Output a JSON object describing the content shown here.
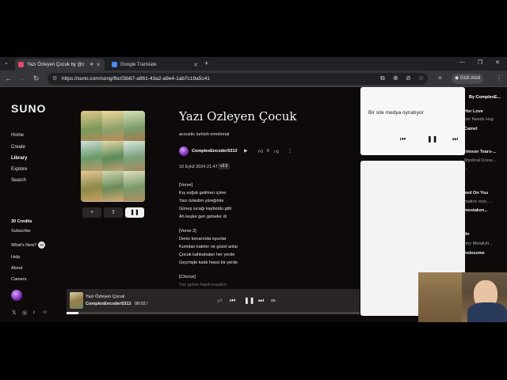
{
  "browser": {
    "tabs": [
      {
        "title": "Yazı Özleyen Çocuk by @c",
        "active": true
      },
      {
        "title": "Google Translate",
        "active": false
      }
    ],
    "url": "https://suno.com/song/fbc03b87-a861-43a2-a9e4-1ab7c19a5c41",
    "incognito_label": "Gizli mod"
  },
  "sidebar": {
    "logo": "SUNO",
    "items": [
      "Home",
      "Create",
      "Library",
      "Explore",
      "Search"
    ],
    "credits": "30 Credits",
    "subscribe": "Subscribe",
    "whats_new": "What's New?",
    "whats_new_count": "20",
    "links": [
      "Help",
      "About",
      "Careers"
    ]
  },
  "song": {
    "title": "Yazı Ozleyen Çocuk",
    "tags": "acoustic turkish emotional",
    "creator": "ComplexEncoder5313",
    "likes": "6",
    "date": "10 Eylül 2024 21:47",
    "version": "v3.5",
    "lyrics": [
      "[Verse]",
      "Kış soğuk gelirken içime",
      "Yazı özledim yüreğimle",
      "Güneş sıcağı kayboldu gitti",
      "Ah keşke geri gelseler di",
      "",
      "[Verse 2]",
      "Deniz kenarında oyunlar",
      "Kumdan kaleler ne güzel anlar",
      "Çocuk kahkahaları her yerde",
      "Geçmişte kaldı hepsi bir yerde",
      "",
      "[Chorus]",
      "Yaz gelsin haydi koşalım"
    ]
  },
  "player": {
    "title": "Yazı Özleyen Çocuk",
    "artist": "ComplexEncoder5313",
    "time": "00:02 / ",
    "progress": 0.04
  },
  "right_list": {
    "header": "By ComplexE...",
    "items": [
      {
        "text": "Hor Love",
        "dim": false
      },
      {
        "text": "hor Needs Hug",
        "dim": true
      },
      {
        "text": "Camel",
        "dim": false
      },
      {
        "text": "rimson Tears-...",
        "dim": false
      },
      {
        "text": "Mystical Cross...",
        "dim": true
      },
      {
        "text": "...",
        "dim": true
      },
      {
        "text": "ked On You",
        "dim": false
      },
      {
        "text": "mative rock, ...",
        "dim": true
      },
      {
        "text": "mestaken...",
        "dim": false
      },
      {
        "text": "de",
        "dim": false
      },
      {
        "text": "ntry MetalUti...",
        "dim": true
      },
      {
        "text": "holesome",
        "dim": false
      }
    ]
  },
  "media_popup": {
    "text": "Bir site medya oynatıyor"
  }
}
